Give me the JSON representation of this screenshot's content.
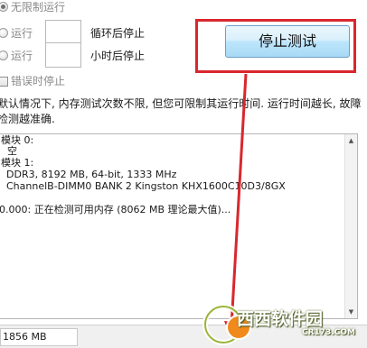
{
  "options": {
    "unlimited_label": "无限制运行",
    "run_label_1": "运行",
    "loop_stop_label": "循环后停止",
    "run_label_2": "运行",
    "hours_stop_label": "小时后停止",
    "stop_on_error_label": "错误时停止"
  },
  "stop_button": {
    "label": "停止测试"
  },
  "description": {
    "line1": "默认情况下, 内存测试次数不限, 但您可限制其运行时间. 运行时间越长, 故障",
    "line2": "检测越准确."
  },
  "log": {
    "lines": [
      "模块 0:",
      "空",
      "模块 1:",
      "DDR3, 8192 MB, 64-bit, 1333 MHz",
      "ChannelB-DIMM0 BANK 2 Kingston KHX1600C10D3/8GX",
      "0.000: 正在检测可用内存 (8062 MB 理论最大值)..."
    ]
  },
  "status": {
    "memory": "1856 MB"
  },
  "watermark": {
    "site_name": "西西软件园",
    "site_url": "CR173.COM"
  },
  "colors": {
    "annotation_red": "#d9272e",
    "button_blue": "#bee6fd"
  }
}
